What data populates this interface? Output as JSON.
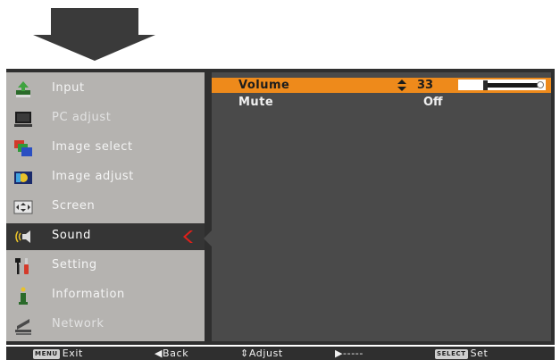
{
  "colors": {
    "accent": "#ee8a1b",
    "pointer": "#e0201a",
    "panel": "#4a4a4a",
    "sidebar": "#b5b3b0"
  },
  "sidebar": {
    "items": [
      {
        "label": "Input",
        "icon": "input-icon"
      },
      {
        "label": "PC adjust",
        "icon": "pc-adjust-icon"
      },
      {
        "label": "Image select",
        "icon": "image-select-icon"
      },
      {
        "label": "Image adjust",
        "icon": "image-adjust-icon"
      },
      {
        "label": "Screen",
        "icon": "screen-icon"
      },
      {
        "label": "Sound",
        "icon": "sound-icon",
        "selected": true
      },
      {
        "label": "Setting",
        "icon": "setting-icon"
      },
      {
        "label": "Information",
        "icon": "information-icon"
      },
      {
        "label": "Network",
        "icon": "network-icon"
      }
    ]
  },
  "panel": {
    "volume": {
      "label": "Volume",
      "value": "33",
      "level": 0.33
    },
    "mute": {
      "label": "Mute",
      "value": "Off"
    }
  },
  "footer": {
    "exit_key": "MENU",
    "exit": "Exit",
    "back": "◀Back",
    "adjust": "Adjust",
    "next": "▶-----",
    "set_key": "SELECT",
    "set": "Set"
  }
}
